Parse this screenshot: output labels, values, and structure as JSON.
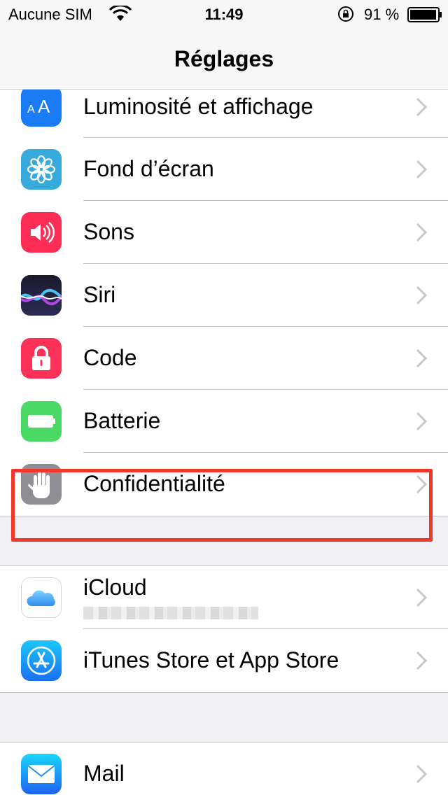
{
  "status_bar": {
    "carrier": "Aucune SIM",
    "time": "11:49",
    "battery_percent": "91 %"
  },
  "nav": {
    "title": "Réglages"
  },
  "groups": [
    {
      "items": [
        {
          "label": "Luminosité et affichage",
          "icon": "display-brightness-icon",
          "color": "#1a7cf5"
        },
        {
          "label": "Fond d’écran",
          "icon": "wallpaper-flower-icon",
          "color": "#36aadc"
        },
        {
          "label": "Sons",
          "icon": "speaker-icon",
          "color": "#fe2d55"
        },
        {
          "label": "Siri",
          "icon": "siri-icon",
          "color": "#222244"
        },
        {
          "label": "Code",
          "icon": "lock-icon",
          "color": "#fd3157"
        },
        {
          "label": "Batterie",
          "icon": "battery-icon",
          "color": "#4cd864"
        },
        {
          "label": "Confidentialité",
          "icon": "hand-icon",
          "color": "#8e8e93"
        }
      ]
    },
    {
      "items": [
        {
          "label": "iCloud",
          "icon": "icloud-icon",
          "color": "#ffffff",
          "highlighted": true
        },
        {
          "label": "iTunes Store et App Store",
          "icon": "app-store-icon",
          "color": "#1e8efb"
        }
      ]
    },
    {
      "items": [
        {
          "label": "Mail",
          "icon": "mail-icon",
          "color": "#1e8efb"
        }
      ]
    }
  ],
  "colors": {
    "highlight": "#f2362a",
    "chevron": "#c7c7cc",
    "separator": "#c8c7cc"
  }
}
